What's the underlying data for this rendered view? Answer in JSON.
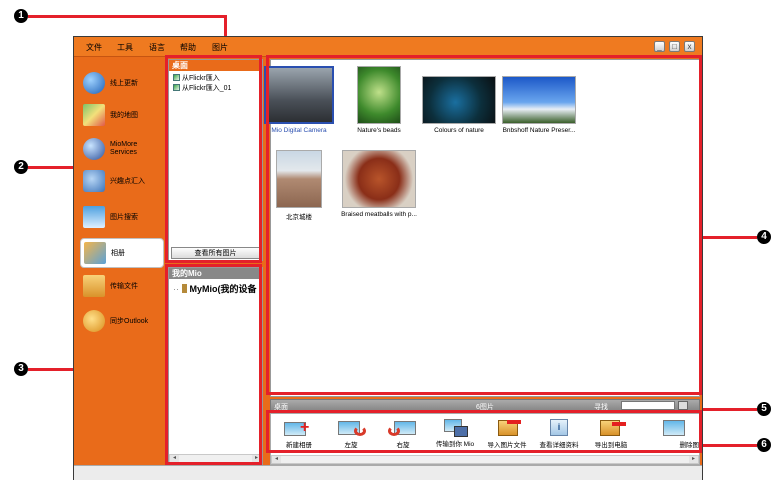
{
  "menu": {
    "file": "文件",
    "tools": "工具",
    "language": "语言",
    "help": "帮助",
    "pictures": "图片"
  },
  "window_controls": {
    "minimize": "_",
    "restore": "□",
    "close": "x"
  },
  "nav": [
    {
      "label": "线上更新",
      "icon": "globe-icon"
    },
    {
      "label": "我的地图",
      "icon": "map-icon"
    },
    {
      "label": "MioMore Services",
      "icon": "services-globe-icon"
    },
    {
      "label": "兴趣点汇入",
      "icon": "poi-import-icon"
    },
    {
      "label": "图片搜索",
      "icon": "image-search-icon"
    },
    {
      "label": "相册",
      "icon": "album-icon"
    },
    {
      "label": "传输文件",
      "icon": "folder-icon"
    },
    {
      "label": "同步Outlook",
      "icon": "outlook-sync-icon"
    }
  ],
  "desktop_panel": {
    "title": "桌面",
    "items": [
      "从Flickr匯入",
      "从Flickr匯入_01"
    ],
    "view_all_button": "查看所有图片"
  },
  "device_panel": {
    "title": "我的Mio",
    "items": [
      "MyMio(我的设备"
    ]
  },
  "gallery": [
    {
      "caption": "Mio Digital Camera",
      "selected": true
    },
    {
      "caption": "Nature's beads",
      "selected": false
    },
    {
      "caption": "Colours of nature",
      "selected": false
    },
    {
      "caption": "Bnbshoff Nature Preser...",
      "selected": false
    },
    {
      "caption": "北京城楼",
      "selected": false
    },
    {
      "caption": "Braised meatballs with p...",
      "selected": false
    }
  ],
  "status": {
    "location": "桌面",
    "count": "6图片",
    "search_label": "寻找",
    "search_value": ""
  },
  "toolbar": [
    {
      "label": "新建相册",
      "icon": "new-album-icon"
    },
    {
      "label": "左旋",
      "icon": "rotate-left-icon"
    },
    {
      "label": "右旋",
      "icon": "rotate-right-icon"
    },
    {
      "label": "传输到你 Mio",
      "icon": "transfer-to-mio-icon"
    },
    {
      "label": "导入图片文件",
      "icon": "import-pictures-icon"
    },
    {
      "label": "查看详细资料",
      "icon": "details-icon"
    },
    {
      "label": "导出到电脑",
      "icon": "export-to-pc-icon"
    },
    {
      "label": "删除图",
      "icon": "delete-picture-icon"
    }
  ],
  "callouts": [
    "1",
    "2",
    "3",
    "4",
    "5",
    "6"
  ],
  "colors": {
    "accent_orange": "#e96b1a",
    "callout_line": "#e4202a",
    "selection_blue": "#2a4fb0"
  }
}
